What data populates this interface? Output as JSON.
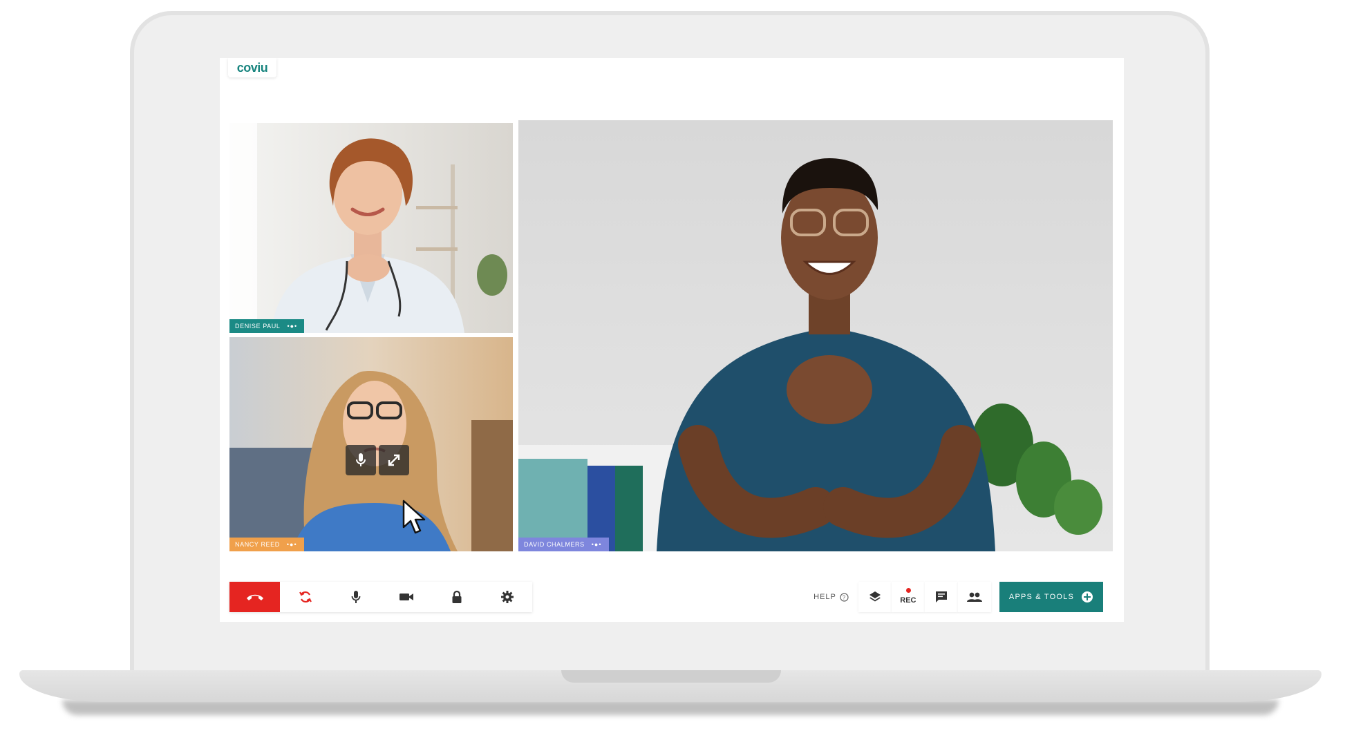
{
  "app": {
    "logo_text": "coviu"
  },
  "participants": [
    {
      "name": "DENISE PAUL",
      "signal": "•●•",
      "tag_color": "#1b8a85"
    },
    {
      "name": "NANCY REED",
      "signal": "•●•",
      "tag_color": "#f0a04b"
    },
    {
      "name": "DAVID CHALMERS",
      "signal": "•●•",
      "tag_color": "#7e86dd"
    }
  ],
  "tile_controls": {
    "mic_icon": "mic-icon",
    "expand_icon": "expand-icon"
  },
  "toolbar": {
    "left_icons": [
      "hang-up-icon",
      "switch-camera-icon",
      "mic-icon",
      "camera-icon",
      "lock-icon",
      "gear-icon"
    ],
    "help_label": "HELP",
    "rec_label": "REC",
    "apps_label": "APPS & TOOLS"
  },
  "colors": {
    "brand": "#197f7a",
    "hangup": "#e52521",
    "rec": "#e52521"
  }
}
